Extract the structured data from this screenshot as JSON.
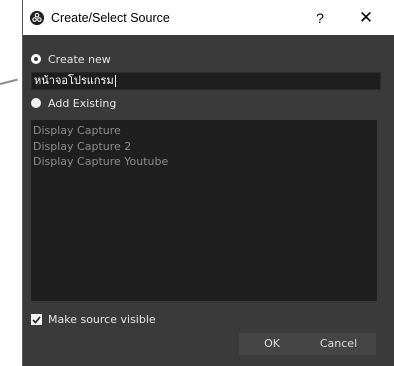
{
  "window": {
    "title": "Create/Select Source",
    "help_label": "?",
    "close_label": "✕"
  },
  "create_new": {
    "label": "Create new",
    "selected": true,
    "input_value": "หน้าจอโปรแกรม"
  },
  "add_existing": {
    "label": "Add Existing",
    "selected": false,
    "items": [
      "Display Capture",
      "Display Capture 2",
      "Display Capture Youtube"
    ]
  },
  "make_visible": {
    "label": "Make source visible",
    "checked": true
  },
  "buttons": {
    "ok": "OK",
    "cancel": "Cancel"
  },
  "colors": {
    "dialog_bg": "#3a3a3a",
    "list_bg": "#1f1f1f",
    "list_text": "#8c8c8c",
    "button_bg": "#454545"
  }
}
